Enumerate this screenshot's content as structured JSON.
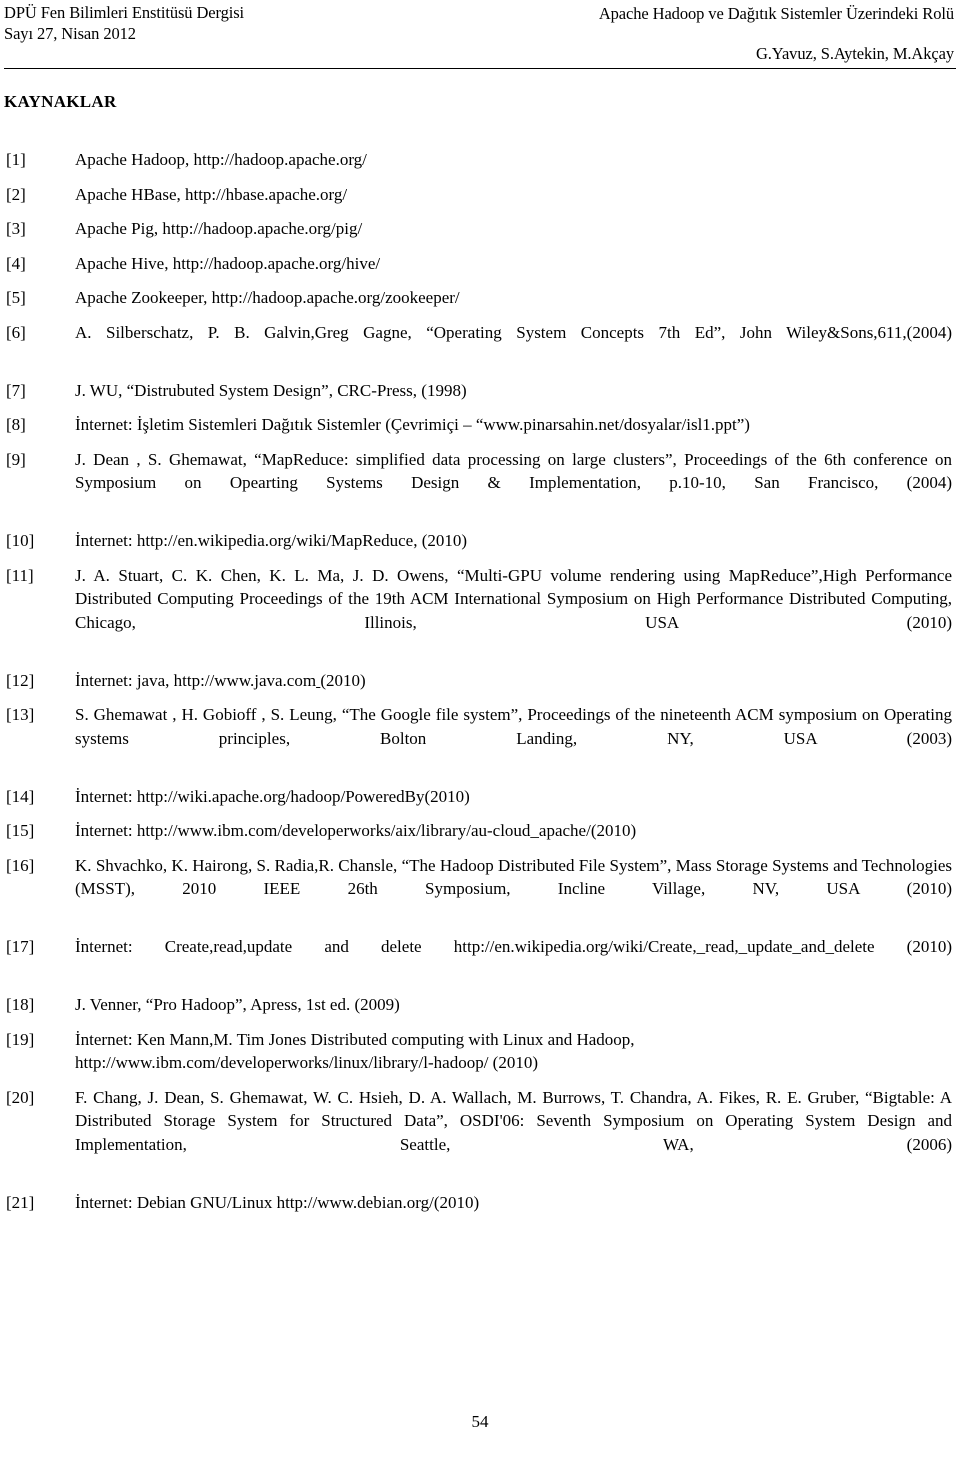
{
  "header": {
    "journal_line1": "DPÜ Fen Bilimleri Enstitüsü Dergisi",
    "journal_line2": "Sayı 27, Nisan  2012",
    "article_title": "Apache Hadoop ve Dağıtık Sistemler Üzerindeki Rolü",
    "authors": "G.Yavuz, S.Aytekin, M.Akçay"
  },
  "section": {
    "title": "KAYNAKLAR"
  },
  "references": [
    {
      "num": "[1]",
      "text": "Apache Hadoop, http://hadoop.apache.org/",
      "justified": false
    },
    {
      "num": "[2]",
      "text": "Apache HBase, http://hbase.apache.org/",
      "justified": false
    },
    {
      "num": "[3]",
      "text": "Apache Pig, http://hadoop.apache.org/pig/",
      "justified": false
    },
    {
      "num": "[4]",
      "text": "Apache Hive, http://hadoop.apache.org/hive/",
      "justified": false
    },
    {
      "num": "[5]",
      "text": "Apache Zookeeper, http://hadoop.apache.org/zookeeper/",
      "justified": false
    },
    {
      "num": "[6]",
      "text": "A. Silberschatz, P. B. Galvin,Greg Gagne, “Operating System Concepts 7th Ed”, John Wiley&Sons,611,(2004)",
      "justified": true
    },
    {
      "num": "[7]",
      "text": "J. WU, “Distrubuted System Design”, CRC-Press, (1998)",
      "justified": false
    },
    {
      "num": "[8]",
      "text": "İnternet: İşletim Sistemleri Dağıtık Sistemler (Çevrimiçi – “www.pinarsahin.net/dosyalar/isl1.ppt”)",
      "justified": false
    },
    {
      "num": "[9]",
      "text": "J. Dean , S. Ghemawat, “MapReduce: simplified data processing on large clusters”, Proceedings of the 6th conference on Symposium on Opearting Systems Design & Implementation, p.10-10, San Francisco, (2004)",
      "justified": true
    },
    {
      "num": "[10]",
      "text": "İnternet: http://en.wikipedia.org/wiki/MapReduce, (2010)",
      "justified": false
    },
    {
      "num": "[11]",
      "text": "J. A. Stuart, C. K. Chen, K. L. Ma, J. D. Owens, “Multi-GPU volume rendering using MapReduce”,High Performance Distributed Computing Proceedings of the 19th ACM International Symposium on High        Performance Distributed Computing, Chicago, Illinois, USA (2010)",
      "justified": true
    },
    {
      "num": "[12]",
      "text": "İnternet: java, http://www.java.com (2010)",
      "justified": false
    },
    {
      "num": "[13]",
      "text": "S. Ghemawat , H. Gobioff , S. Leung, “The Google file system”, Proceedings of the nineteenth ACM symposium on Operating systems principles,  Bolton Landing, NY, USA (2003)",
      "justified": true
    },
    {
      "num": "[14]",
      "text": "İnternet: http://wiki.apache.org/hadoop/PoweredBy(2010)",
      "justified": false
    },
    {
      "num": "[15]",
      "text": "İnternet: http://www.ibm.com/developerworks/aix/library/au-cloud_apache/(2010)",
      "justified": false
    },
    {
      "num": "[16]",
      "text": "K. Shvachko, K. Hairong, S. Radia,R. Chansle, “The Hadoop Distributed File System”, Mass Storage Systems and Technologies (MSST), 2010 IEEE 26th Symposium, Incline Village, NV, USA (2010)",
      "justified": true
    },
    {
      "num": "[17]",
      "text": "İnternet: Create,read,update and delete http://en.wikipedia.org/wiki/Create,_read,_update_and_delete (2010)",
      "justified": true
    },
    {
      "num": "[18]",
      "text": "J. Venner, “Pro Hadoop”, Apress, 1st ed. (2009)",
      "justified": false
    },
    {
      "num": "[19]",
      "text": "İnternet: Ken Mann,M. Tim Jones Distributed computing with Linux and Hadoop, http://www.ibm.com/developerworks/linux/library/l-hadoop/ (2010)",
      "justified": false
    },
    {
      "num": "[20]",
      "text": "F. Chang, J. Dean, S. Ghemawat, W. C. Hsieh, D. A. Wallach, M. Burrows, T. Chandra, A. Fikes, R. E. Gruber, “Bigtable: A Distributed Storage System for Structured Data”, OSDI'06: Seventh Symposium on Operating System Design and Implementation, Seattle, WA, (2006)",
      "justified": true
    },
    {
      "num": "[21]",
      "text": "İnternet: Debian GNU/Linux http://www.debian.org/(2010)",
      "justified": false
    }
  ],
  "footer": {
    "page_number": "54"
  }
}
